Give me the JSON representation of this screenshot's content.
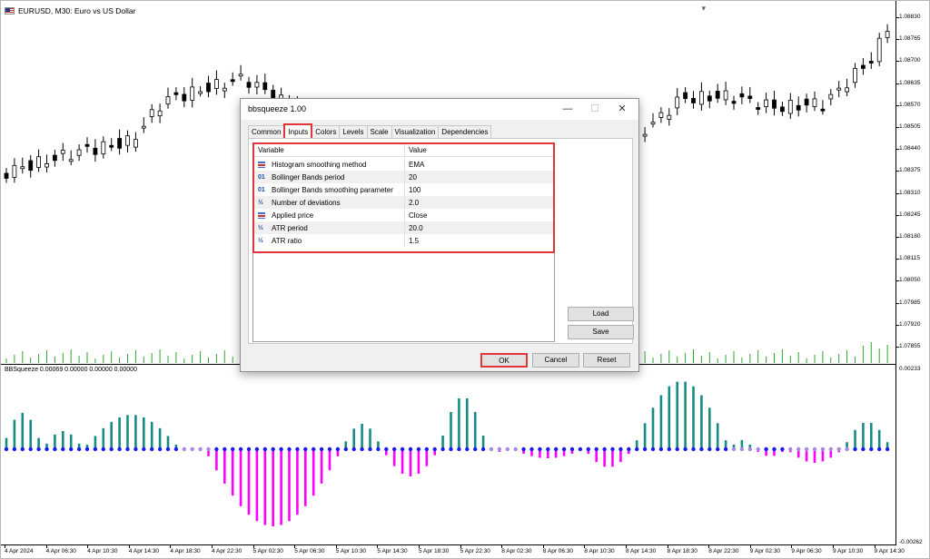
{
  "chart": {
    "title": "EURUSD, M30: Euro vs US Dollar",
    "indicator_label": "BBSqueeze 0.00069 0.00000 0.00000 0.00000",
    "price_labels": [
      "1.08830",
      "1.08765",
      "1.08700",
      "1.08635",
      "1.08570",
      "1.08505",
      "1.08440",
      "1.08375",
      "1.08310",
      "1.08245",
      "1.08180",
      "1.08115",
      "1.08050",
      "1.07985",
      "1.07920",
      "1.07855"
    ],
    "indicator_labels": [
      "0.00233",
      "-0.00262"
    ],
    "time_labels": [
      "4 Apr 2024",
      "4 Apr 06:30",
      "4 Apr 10:30",
      "4 Apr 14:30",
      "4 Apr 18:30",
      "4 Apr 22:30",
      "5 Apr 02:30",
      "5 Apr 06:30",
      "5 Apr 10:30",
      "5 Apr 14:30",
      "5 Apr 18:30",
      "5 Apr 22:30",
      "8 Apr 02:30",
      "8 Apr 06:30",
      "8 Apr 10:30",
      "8 Apr 14:30",
      "8 Apr 18:30",
      "8 Apr 22:30",
      "9 Apr 02:30",
      "9 Apr 06:30",
      "9 Apr 10:30",
      "9 Apr 14:30"
    ],
    "colors": {
      "bull_hist": "#168c85",
      "bear_hist": "#ff00ff",
      "squeeze_dot": "#1a1af0",
      "nosqueeze_dot": "#a78ae0",
      "volume": "#2ea82e"
    }
  },
  "dialog": {
    "title": "bbsqueeze 1.00",
    "tabs": [
      "Common",
      "Inputs",
      "Colors",
      "Levels",
      "Scale",
      "Visualization",
      "Dependencies"
    ],
    "active_tab": "Inputs",
    "table_headers": {
      "variable": "Variable",
      "value": "Value"
    },
    "params": [
      {
        "icon": "enum-icon",
        "name": "Histogram smoothing method",
        "value": "EMA"
      },
      {
        "icon": "int-icon",
        "icon_text": "01",
        "name": "Bollinger Bands period",
        "value": "20"
      },
      {
        "icon": "int-icon",
        "icon_text": "01",
        "name": "Bollinger Bands smoothing parameter",
        "value": "100"
      },
      {
        "icon": "double-icon",
        "icon_text": "½",
        "name": "Number of deviations",
        "value": "2.0"
      },
      {
        "icon": "enum-icon",
        "name": "Applied price",
        "value": "Close"
      },
      {
        "icon": "double-icon",
        "icon_text": "½",
        "name": "ATR period",
        "value": "20.0"
      },
      {
        "icon": "double-icon",
        "icon_text": "½",
        "name": "ATR ratio",
        "value": "1.5"
      }
    ],
    "buttons": {
      "load": "Load",
      "save": "Save",
      "ok": "OK",
      "cancel": "Cancel",
      "reset": "Reset"
    }
  }
}
